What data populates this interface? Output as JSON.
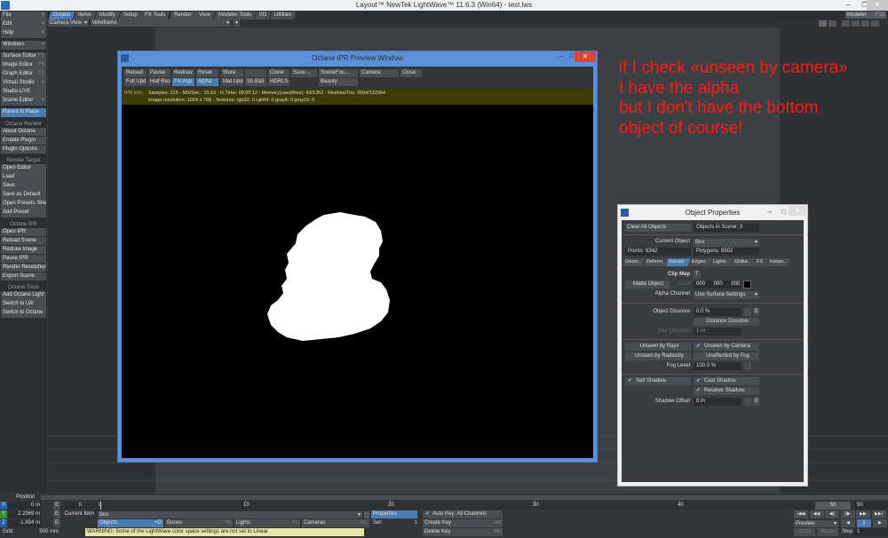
{
  "window": {
    "title": "Layout™ NewTek LightWave™ 11.6.3 (Win64) - test.lws",
    "minimize": "–",
    "restore": "❐",
    "close": "✕"
  },
  "sidebar": {
    "group1": [
      {
        "label": "File",
        "arrow": "▾"
      },
      {
        "label": "Edit",
        "arrow": "▾"
      },
      {
        "label": "Help",
        "arrow": "▾"
      }
    ],
    "windows": {
      "label": "Windows",
      "arrow": "▾"
    },
    "group2": [
      {
        "label": "Surface Editor",
        "key": "F5"
      },
      {
        "label": "Image Editor",
        "key": "F6"
      },
      {
        "label": "Graph Editor",
        "key": "F2"
      },
      {
        "label": "Virtual Studio",
        "key": "▾"
      },
      {
        "label": "Studio LIVE",
        "key": ""
      },
      {
        "label": "Scene Editor",
        "key": "▾"
      }
    ],
    "parent_in_place": "Parent in Place",
    "sections": [
      {
        "header": "Octane Render",
        "items": [
          "About Octane",
          "Enable Plugin",
          "Plugin Options"
        ]
      },
      {
        "header": "Render Target",
        "items": [
          "Open Editor",
          "Load",
          "Save",
          "Save as Default",
          "Open Presets Shelf",
          "Add Preset"
        ]
      },
      {
        "header": "Octane IPR",
        "items": [
          "Open IPR",
          "Reload Scene",
          "Redraw Image",
          "Pause IPR",
          "Render Resolution",
          "Export Scene"
        ]
      },
      {
        "header": "Octane Tools",
        "items": [
          "Add Octane Light",
          "Switch to LW",
          "Switch to Octane"
        ]
      }
    ]
  },
  "tabs": [
    {
      "label": "Octane",
      "active": true
    },
    {
      "label": "Items"
    },
    {
      "label": "Modify"
    },
    {
      "label": "Setup"
    },
    {
      "label": "FX Tools"
    },
    {
      "label": "Render"
    },
    {
      "label": "View"
    },
    {
      "label": "Modeler Tools"
    },
    {
      "label": "I/O"
    },
    {
      "label": "Utilities"
    }
  ],
  "modeler": {
    "label": "Modeler",
    "key": "F12"
  },
  "viewport": {
    "view": "Camera View",
    "mode": "Wireframe"
  },
  "ipr": {
    "title": "Octane IPR Preview Window",
    "row1": [
      "Reload",
      "Pause",
      "Redraw",
      "Reset",
      "Store",
      "",
      "Clone",
      "Save ...",
      "SceneFoc...",
      "Camera",
      "Close"
    ],
    "row2": [
      "Full Upd",
      "Half Res",
      "Fix Asp.",
      "Alpha",
      "Mat Upd",
      "Sh.Ball",
      "HDRLS",
      "Beauty"
    ],
    "info_label": "IPR Info:",
    "info_line1": "Samples: 215  -  MS/Sec.: 15.63  -  R.Time: 00:00:12 - Memory(used/free): 43/1262  -  Meshes/Tris: 2604/122964",
    "info_line2": "Image resolution: 1024 x 768 - Textures: rgb32: 0   rgb64: 0   gray8: 0   gray16: 0",
    "minimize": "–",
    "maximize": "□",
    "close": "✕"
  },
  "annotation": {
    "lines": [
      "if I check «unseen by camera»",
      "I have the alpha",
      "but I don't have the bottom",
      "object of course!"
    ],
    "color": "#ff1a1a"
  },
  "object_properties": {
    "title": "Object Properties",
    "clear_all": "Clear All Objects",
    "objects_in_scene": "Objects in Scene: 3",
    "current_object_label": "Current Object",
    "current_object": "Box",
    "points": "Points: 6342",
    "polygons": "Polygons: 6502",
    "tabs": [
      "Geom..",
      "Deform",
      "Render",
      "Edges",
      "Lights",
      "Globa..",
      "FX",
      "Instan.."
    ],
    "active_tab": "Render",
    "clip_map": "Clip Map",
    "clip_map_btn": "T",
    "matte_object": "Matte Object",
    "color_label": "Color",
    "color_values": [
      "000",
      "000",
      "000"
    ],
    "alpha_channel_label": "Alpha Channel",
    "alpha_channel": "Use Surface Settings",
    "object_dissolve_label": "Object Dissolve",
    "object_dissolve": "0.0 %",
    "distance_dissolve": "Distance Dissolve",
    "max_distance_label": "Max Distance",
    "max_distance": "1 m",
    "unseen_by_rays": {
      "label": "Unseen by Rays",
      "checked": false
    },
    "unseen_by_camera": {
      "label": "Unseen by Camera",
      "checked": true
    },
    "unseen_by_radiosity": {
      "label": "Unseen by Radiosity",
      "checked": false
    },
    "unaffected_by_fog": {
      "label": "Unaffected by Fog",
      "checked": false
    },
    "fog_level_label": "Fog Level",
    "fog_level": "100.0 %",
    "self_shadow": {
      "label": "Self Shadow",
      "checked": true
    },
    "cast_shadow": {
      "label": "Cast Shadow",
      "checked": true
    },
    "receive_shadow": {
      "label": "Receive Shadow",
      "checked": true
    },
    "shadow_offset_label": "Shadow Offset",
    "shadow_offset": "0 m",
    "e": "E",
    "min": "–",
    "max": "□",
    "close": "✕"
  },
  "bottom": {
    "position_label": "Position",
    "x_label": "X",
    "x": "0 m",
    "y_label": "Y",
    "y": "2.2369 m",
    "z_label": "Z",
    "z": "-1.894 m",
    "grid_label": "Grid",
    "grid": "500 mm",
    "frame_start": "0",
    "ticks": [
      "0",
      "10",
      "20",
      "30",
      "40"
    ],
    "end_frame": "50",
    "end_field": "50",
    "current_item_label": "Current Item",
    "current_item": "Box",
    "properties": "Properties",
    "auto_key": "Auto Key: All Channels",
    "create_key": "Create Key",
    "create_key_short": "ret",
    "delete_key": "Delete Key",
    "delete_key_short": "del",
    "objects": "Objects",
    "objects_key": "+O",
    "bones": "Bones",
    "bones_key": "+B",
    "lights": "Lights",
    "lights_key": "+L",
    "cameras": "Cameras",
    "cameras_key": "+C",
    "sel_label": "Sel:",
    "sel": "1",
    "warning": "WARNING: Some of the LightWave color space settings are not set to Linear",
    "preview": "Preview",
    "undo": "Undo",
    "redo": "Redo",
    "step_label": "Step",
    "step": "1",
    "transport": [
      "|◀◀",
      "◀◀",
      "◀||",
      "||▶",
      "▶▶",
      "▶▶|"
    ],
    "play": [
      "◀",
      "||",
      "▶"
    ]
  }
}
